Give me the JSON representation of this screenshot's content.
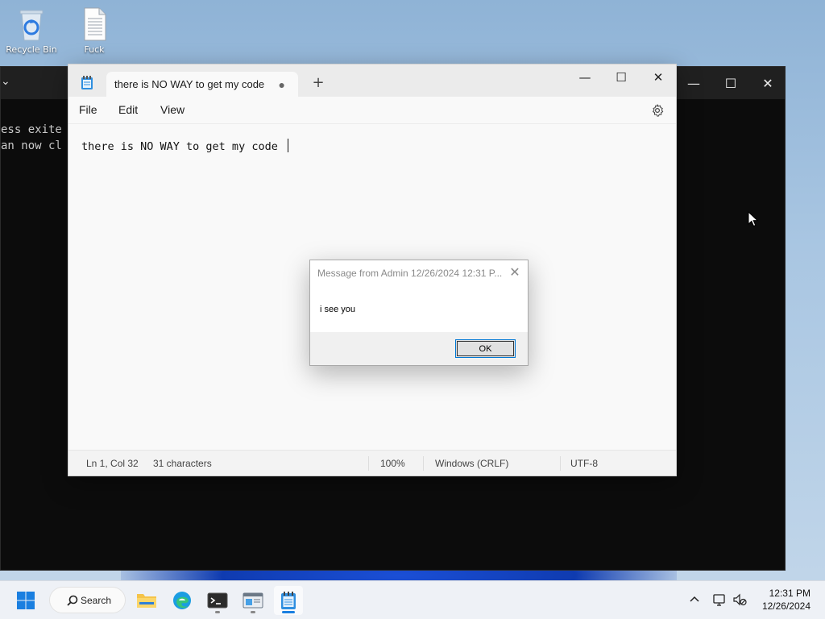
{
  "desktop": {
    "icons": [
      {
        "label": "Recycle Bin"
      },
      {
        "label": "Fuck"
      }
    ]
  },
  "terminal": {
    "output_lines": [
      "ess exite",
      "an now cl"
    ]
  },
  "notepad": {
    "tab_title": "there is NO WAY to get my code",
    "tab_unsaved_marker": "●",
    "new_tab_label": "+",
    "window_controls": {
      "minimize": "—",
      "maximize": "☐",
      "close": "✕"
    },
    "menu": {
      "file": "File",
      "edit": "Edit",
      "view": "View"
    },
    "content": "there is NO WAY to get my code ",
    "status": {
      "position": "Ln 1, Col 32",
      "characters": "31 characters",
      "zoom": "100%",
      "line_endings": "Windows (CRLF)",
      "encoding": "UTF-8"
    }
  },
  "message_box": {
    "title": "Message from Admin 12/26/2024 12:31 P...",
    "body": "i see you",
    "ok_label": "OK",
    "close_glyph": "✕"
  },
  "taskbar": {
    "search_label": "Search",
    "time": "12:31 PM",
    "date": "12/26/2024"
  }
}
